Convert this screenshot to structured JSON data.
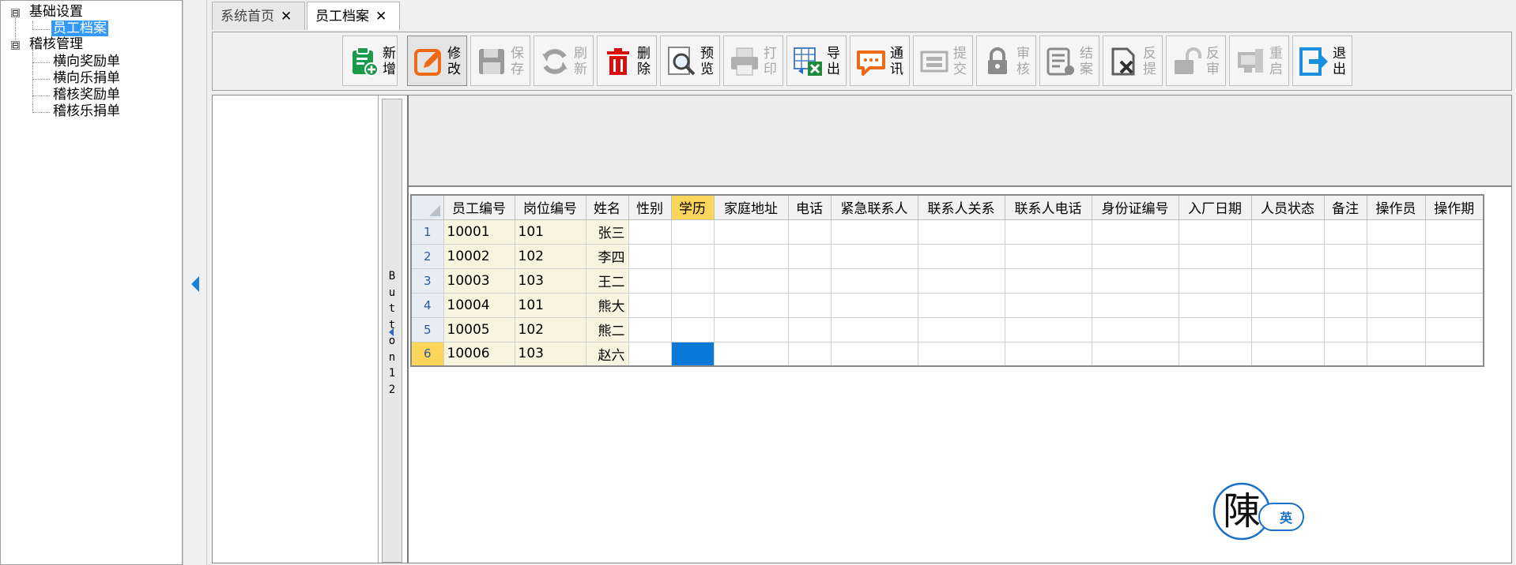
{
  "tree": {
    "groups": [
      {
        "label": "基础设置",
        "toggle": "⊟",
        "children": [
          {
            "label": "员工档案",
            "selected": true
          }
        ]
      },
      {
        "label": "稽核管理",
        "toggle": "⊟",
        "children": [
          {
            "label": "横向奖励单"
          },
          {
            "label": "横向乐捐单"
          },
          {
            "label": "稽核奖励单"
          },
          {
            "label": "稽核乐捐单"
          }
        ]
      }
    ]
  },
  "tabs": [
    {
      "label": "系统首页",
      "close": "✕",
      "active": false
    },
    {
      "label": "员工档案",
      "close": "✕",
      "active": true
    }
  ],
  "toolbar": {
    "buttons": [
      {
        "l1": "新",
        "l2": "增",
        "icon": "clipboard-add-icon",
        "enabled": true
      },
      {
        "l1": "修",
        "l2": "改",
        "icon": "edit-pencil-icon",
        "enabled": true,
        "pressed": true
      },
      {
        "l1": "保",
        "l2": "存",
        "icon": "save-disk-icon",
        "enabled": false
      },
      {
        "l1": "刷",
        "l2": "新",
        "icon": "refresh-icon",
        "enabled": false
      },
      {
        "l1": "删",
        "l2": "除",
        "icon": "trash-icon",
        "enabled": true
      },
      {
        "l1": "预",
        "l2": "览",
        "icon": "preview-magnifier-icon",
        "enabled": true
      },
      {
        "l1": "打",
        "l2": "印",
        "icon": "printer-icon",
        "enabled": false
      },
      {
        "l1": "导",
        "l2": "出",
        "icon": "export-excel-icon",
        "enabled": true
      },
      {
        "l1": "通",
        "l2": "讯",
        "icon": "chat-bubble-icon",
        "enabled": true
      },
      {
        "l1": "提",
        "l2": "交",
        "icon": "submit-flow-icon",
        "enabled": false
      },
      {
        "l1": "审",
        "l2": "核",
        "icon": "lock-icon",
        "enabled": false
      },
      {
        "l1": "结",
        "l2": "案",
        "icon": "close-case-icon",
        "enabled": false
      },
      {
        "l1": "反",
        "l2": "提",
        "icon": "unsubmit-icon",
        "enabled": false
      },
      {
        "l1": "反",
        "l2": "审",
        "icon": "unlock-icon",
        "enabled": false
      },
      {
        "l1": "重",
        "l2": "启",
        "icon": "restart-icon",
        "enabled": false
      },
      {
        "l1": "退",
        "l2": "出",
        "icon": "exit-icon",
        "enabled": true
      }
    ]
  },
  "vbutton": {
    "label": "Button12"
  },
  "grid": {
    "columns": [
      "员工编号",
      "岗位编号",
      "姓名",
      "性别",
      "学历",
      "家庭地址",
      "电话",
      "紧急联系人",
      "联系人关系",
      "联系人电话",
      "身份证编号",
      "入厂日期",
      "人员状态",
      "备注",
      "操作员",
      "操作期"
    ],
    "selected_column": 4,
    "current_row": 6,
    "rows": [
      {
        "num": "1",
        "cells": [
          "10001",
          "101",
          "张三",
          "",
          "",
          "",
          "",
          "",
          "",
          "",
          "",
          "",
          "",
          "",
          "",
          ""
        ]
      },
      {
        "num": "2",
        "cells": [
          "10002",
          "102",
          "李四",
          "",
          "",
          "",
          "",
          "",
          "",
          "",
          "",
          "",
          "",
          "",
          "",
          ""
        ]
      },
      {
        "num": "3",
        "cells": [
          "10003",
          "103",
          "王二",
          "",
          "",
          "",
          "",
          "",
          "",
          "",
          "",
          "",
          "",
          "",
          "",
          ""
        ]
      },
      {
        "num": "4",
        "cells": [
          "10004",
          "101",
          "熊大",
          "",
          "",
          "",
          "",
          "",
          "",
          "",
          "",
          "",
          "",
          "",
          "",
          ""
        ]
      },
      {
        "num": "5",
        "cells": [
          "10005",
          "102",
          "熊二",
          "",
          "",
          "",
          "",
          "",
          "",
          "",
          "",
          "",
          "",
          "",
          "",
          ""
        ]
      },
      {
        "num": "6",
        "cells": [
          "10006",
          "103",
          "赵六",
          "",
          "",
          "",
          "",
          "",
          "",
          "",
          "",
          "",
          "",
          "",
          "",
          ""
        ]
      }
    ]
  },
  "logo": {
    "glyph": "陳",
    "badge": "英"
  }
}
